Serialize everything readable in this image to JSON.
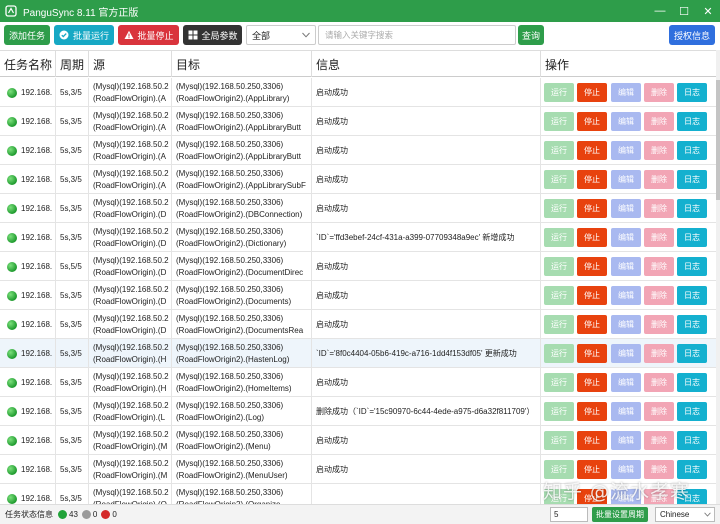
{
  "window": {
    "title": "PanguSync 8.11 官方正版",
    "controls": {
      "minimize": "—",
      "maximize": "☐",
      "close": "✕"
    }
  },
  "toolbar": {
    "add_task": "添加任务",
    "batch_run": "批量运行",
    "batch_stop": "批量停止",
    "global_params": "全局参数",
    "scope_select": "全部",
    "search_placeholder": "请输入关键字搜索",
    "query": "查询",
    "license": "授权信息"
  },
  "table": {
    "headers": {
      "name": "任务名称",
      "period": "周期",
      "source": "源",
      "target": "目标",
      "info": "信息",
      "ops": "操作"
    },
    "op_labels": {
      "run": "运行",
      "stop": "停止",
      "edit": "编辑",
      "delete": "删除",
      "log": "日志"
    },
    "rows": [
      {
        "name": "192.168.",
        "period": "5s,3/5",
        "src1": "(Mysql)(192.168.50.2",
        "src2": "(RoadFlowOrigin).(A",
        "tgt1": "(Mysql)(192.168.50.250,3306)",
        "tgt2": "(RoadFlowOrigin2).(AppLibrary)",
        "info": "启动成功"
      },
      {
        "name": "192.168.",
        "period": "5s,3/5",
        "src1": "(Mysql)(192.168.50.2",
        "src2": "(RoadFlowOrigin).(A",
        "tgt1": "(Mysql)(192.168.50.250,3306)",
        "tgt2": "(RoadFlowOrigin2).(AppLibraryButt",
        "info": "启动成功"
      },
      {
        "name": "192.168.",
        "period": "5s,3/5",
        "src1": "(Mysql)(192.168.50.2",
        "src2": "(RoadFlowOrigin).(A",
        "tgt1": "(Mysql)(192.168.50.250,3306)",
        "tgt2": "(RoadFlowOrigin2).(AppLibraryButt",
        "info": "启动成功"
      },
      {
        "name": "192.168.",
        "period": "5s,3/5",
        "src1": "(Mysql)(192.168.50.2",
        "src2": "(RoadFlowOrigin).(A",
        "tgt1": "(Mysql)(192.168.50.250,3306)",
        "tgt2": "(RoadFlowOrigin2).(AppLibrarySubF",
        "info": "启动成功"
      },
      {
        "name": "192.168.",
        "period": "5s,3/5",
        "src1": "(Mysql)(192.168.50.2",
        "src2": "(RoadFlowOrigin).(D",
        "tgt1": "(Mysql)(192.168.50.250,3306)",
        "tgt2": "(RoadFlowOrigin2).(DBConnection)",
        "info": "启动成功"
      },
      {
        "name": "192.168.",
        "period": "5s,3/5",
        "src1": "(Mysql)(192.168.50.2",
        "src2": "(RoadFlowOrigin).(D",
        "tgt1": "(Mysql)(192.168.50.250,3306)",
        "tgt2": "(RoadFlowOrigin2).(Dictionary)",
        "info": "`ID`='ffd3ebef-24cf-431a-a399-07709348a9ec' 新增成功"
      },
      {
        "name": "192.168.",
        "period": "5s,5/5",
        "src1": "(Mysql)(192.168.50.2",
        "src2": "(RoadFlowOrigin).(D",
        "tgt1": "(Mysql)(192.168.50.250,3306)",
        "tgt2": "(RoadFlowOrigin2).(DocumentDirec",
        "info": "启动成功"
      },
      {
        "name": "192.168.",
        "period": "5s,3/5",
        "src1": "(Mysql)(192.168.50.2",
        "src2": "(RoadFlowOrigin).(D",
        "tgt1": "(Mysql)(192.168.50.250,3306)",
        "tgt2": "(RoadFlowOrigin2).(Documents)",
        "info": "启动成功"
      },
      {
        "name": "192.168.",
        "period": "5s,3/5",
        "src1": "(Mysql)(192.168.50.2",
        "src2": "(RoadFlowOrigin).(D",
        "tgt1": "(Mysql)(192.168.50.250,3306)",
        "tgt2": "(RoadFlowOrigin2).(DocumentsRea",
        "info": "启动成功"
      },
      {
        "name": "192.168.",
        "period": "5s,3/5",
        "src1": "(Mysql)(192.168.50.2",
        "src2": "(RoadFlowOrigin).(H",
        "tgt1": "(Mysql)(192.168.50.250,3306)",
        "tgt2": "(RoadFlowOrigin2).(HastenLog)",
        "info": "`ID`='8f0c4404-05b6-419c-a716-1dd4f153df05' 更新成功"
      },
      {
        "name": "192.168.",
        "period": "5s,3/5",
        "src1": "(Mysql)(192.168.50.2",
        "src2": "(RoadFlowOrigin).(H",
        "tgt1": "(Mysql)(192.168.50.250,3306)",
        "tgt2": "(RoadFlowOrigin2).(HomeItems)",
        "info": "启动成功"
      },
      {
        "name": "192.168.",
        "period": "5s,3/5",
        "src1": "(Mysql)(192.168.50.2",
        "src2": "(RoadFlowOrigin).(L",
        "tgt1": "(Mysql)(192.168.50.250,3306)",
        "tgt2": "(RoadFlowOrigin2).(Log)",
        "info": "删除成功（`ID`='15c90970-6c44-4ede-a975-d6a32f811709'）"
      },
      {
        "name": "192.168.",
        "period": "5s,3/5",
        "src1": "(Mysql)(192.168.50.2",
        "src2": "(RoadFlowOrigin).(M",
        "tgt1": "(Mysql)(192.168.50.250,3306)",
        "tgt2": "(RoadFlowOrigin2).(Menu)",
        "info": "启动成功"
      },
      {
        "name": "192.168.",
        "period": "5s,3/5",
        "src1": "(Mysql)(192.168.50.2",
        "src2": "(RoadFlowOrigin).(M",
        "tgt1": "(Mysql)(192.168.50.250,3306)",
        "tgt2": "(RoadFlowOrigin2).(MenuUser)",
        "info": "启动成功"
      },
      {
        "name": "192.168.",
        "period": "5s,3/5",
        "src1": "(Mysql)(192.168.50.2",
        "src2": "(RoadFlowOrigin).(O",
        "tgt1": "(Mysql)(192.168.50.250,3306)",
        "tgt2": "(RoadFlowOrigin2).(Organize",
        "info": ""
      }
    ]
  },
  "statusbar": {
    "label": "任务状态信息",
    "running_count": "43",
    "idle_count": "0",
    "error_count": "0",
    "period_value": "5",
    "set_period": "批量设置周期",
    "language": "Chinese"
  },
  "watermark": "知乎 @流水孝寒",
  "colors": {
    "brand": "#2e9d4a",
    "stop": "#e8420e",
    "log": "#14b0cf",
    "batch_stop": "#d9343c",
    "license": "#2f6fde",
    "batch_run": "#16a8c4"
  }
}
